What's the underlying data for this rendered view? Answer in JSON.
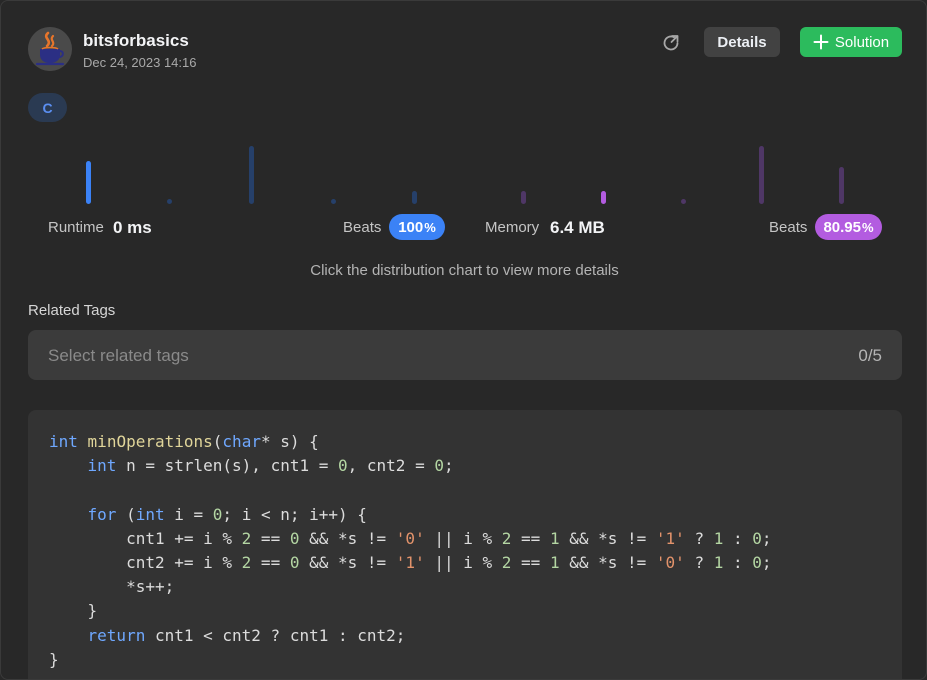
{
  "author": {
    "name": "bitsforbasics",
    "date": "Dec 24, 2023 14:16"
  },
  "icons": {
    "share": "share-icon",
    "plus": "plus-icon",
    "avatar": "java-cup-avatar"
  },
  "buttons": {
    "details": "Details",
    "solution": "Solution"
  },
  "language": "C",
  "stats": {
    "runtime_label": "Runtime",
    "runtime_value": "0 ms",
    "runtime_beats_label": "Beats",
    "runtime_beats_value": "100",
    "runtime_beats_unit": "%",
    "memory_label": "Memory",
    "memory_value": "6.4 MB",
    "memory_beats_label": "Beats",
    "memory_beats_value": "80.95",
    "memory_beats_unit": "%"
  },
  "distribution": {
    "runtime_bars": [
      1.0,
      0.1,
      1.35,
      0.1,
      0.3
    ],
    "runtime_active_index": 0,
    "memory_bars": [
      0.3,
      0.3,
      0.1,
      1.35,
      0.85
    ],
    "memory_active_index": 1
  },
  "colors": {
    "runtime_active": "#3b82f6",
    "runtime_inactive": "#26406a",
    "memory_active": "#b35ce0",
    "memory_inactive": "#4f3766",
    "solution_green": "#2cbb5d"
  },
  "hint": "Click the distribution chart to view more details",
  "related_tags": {
    "label": "Related Tags",
    "placeholder": "Select related tags",
    "count": "0/5"
  },
  "code_lines": [
    [
      [
        "kw",
        "int"
      ],
      [
        "",
        "·"
      ],
      [
        "fn",
        "minOperations"
      ],
      [
        "",
        "("
      ],
      [
        "kw",
        "char"
      ],
      [
        "",
        "* s) {"
      ]
    ],
    [
      [
        "",
        "    "
      ],
      [
        "kw",
        "int"
      ],
      [
        "",
        ""
      ],
      [
        "",
        ""
      ],
      [
        "",
        "·n = strlen(s), cnt1 = "
      ],
      [
        "num",
        "0"
      ],
      [
        "",
        ", cnt2 = "
      ],
      [
        "num",
        "0"
      ],
      [
        "",
        ";"
      ]
    ],
    [],
    [
      [
        "",
        "    "
      ],
      [
        "kw",
        "for"
      ],
      [
        "",
        "·("
      ],
      [
        "kw",
        "int"
      ],
      [
        "",
        "·i = "
      ],
      [
        "num",
        "0"
      ],
      [
        "",
        "; i < n; i++) {"
      ]
    ],
    [
      [
        "",
        "        cnt1 += i % "
      ],
      [
        "num",
        "2"
      ],
      [
        "",
        ""
      ],
      [
        "",
        ""
      ],
      [
        "",
        "·== "
      ],
      [
        "num",
        "0"
      ],
      [
        "",
        "·&& *s != "
      ],
      [
        "str",
        "'0'"
      ],
      [
        "",
        "·|| i % "
      ],
      [
        "num",
        "2"
      ],
      [
        "",
        "·== "
      ],
      [
        "num",
        "1"
      ],
      [
        "",
        "·&& *s != "
      ],
      [
        "str",
        "'1'"
      ],
      [
        "",
        "·? "
      ],
      [
        "num",
        "1"
      ],
      [
        "",
        "·: "
      ],
      [
        "num",
        "0"
      ],
      [
        "",
        ";"
      ]
    ],
    [
      [
        "",
        "        cnt2 += i % "
      ],
      [
        "num",
        "2"
      ],
      [
        "",
        "·== "
      ],
      [
        "num",
        "0"
      ],
      [
        "",
        "·&& *s != "
      ],
      [
        "str",
        "'1'"
      ],
      [
        "",
        "·|| i % "
      ],
      [
        "num",
        "2"
      ],
      [
        "",
        "·== "
      ],
      [
        "num",
        "1"
      ],
      [
        "",
        "·&& *s != "
      ],
      [
        "str",
        "'0'"
      ],
      [
        "",
        "·? "
      ],
      [
        "num",
        "1"
      ],
      [
        "",
        "·: "
      ],
      [
        "num",
        "0"
      ],
      [
        "",
        ";"
      ]
    ],
    [
      [
        "",
        "        *s++;"
      ]
    ],
    [
      [
        "",
        "    }"
      ]
    ],
    [
      [
        "",
        "    "
      ],
      [
        "kw",
        "return"
      ],
      [
        "",
        "·cnt1 < cnt2 ? cnt1 : cnt2;"
      ]
    ],
    [
      [
        "",
        "}"
      ]
    ]
  ],
  "code_colors": {
    "kw": "#6fa8ff",
    "fn": "#e0d59a",
    "num": "#b4d6a3",
    "str": "#e3936b",
    "plain": "#dcdcdc"
  }
}
